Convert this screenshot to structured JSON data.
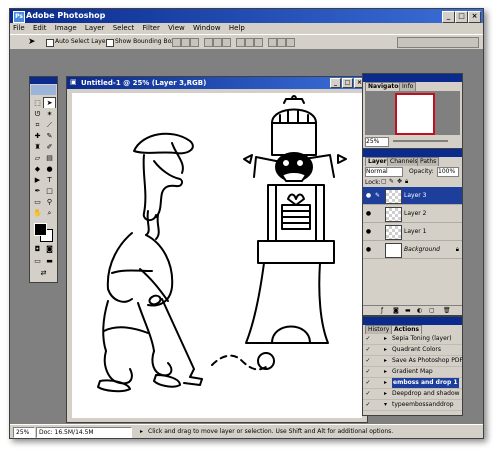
{
  "app": {
    "title": "Adobe Photoshop"
  },
  "menu": [
    "File",
    "Edit",
    "Image",
    "Layer",
    "Select",
    "Filter",
    "View",
    "Window",
    "Help"
  ],
  "options": {
    "auto_select_label": "Auto Select Layer",
    "bounding_box_label": "Show Bounding Box"
  },
  "document": {
    "title": "Untitled-1 @ 25% (Layer 3,RGB)"
  },
  "navigator": {
    "tabs": [
      "Navigator",
      "Info"
    ],
    "zoom": "25%"
  },
  "layers": {
    "tabs": [
      "Layers",
      "Channels",
      "Paths"
    ],
    "blend_mode": "Normal",
    "opacity_label": "Opacity:",
    "opacity_value": "100%",
    "lock_label": "Lock:",
    "items": [
      {
        "name": "Layer 3",
        "selected": true
      },
      {
        "name": "Layer 2",
        "selected": false
      },
      {
        "name": "Layer 1",
        "selected": false
      },
      {
        "name": "Background",
        "selected": false
      }
    ]
  },
  "actions": {
    "tabs": [
      "History",
      "Actions"
    ],
    "items": [
      {
        "name": "Sepia Toning (layer)",
        "selected": false
      },
      {
        "name": "Quadrant Colors",
        "selected": false
      },
      {
        "name": "Save As Photoshop PDF",
        "selected": false
      },
      {
        "name": "Gradient Map",
        "selected": false
      },
      {
        "name": "emboss and drop 1",
        "selected": true
      },
      {
        "name": "Deepdrop and shadow",
        "selected": false
      },
      {
        "name": "typeembossanddrop",
        "selected": false
      }
    ]
  },
  "status": {
    "zoom": "25%",
    "doc_size": "Doc: 16.5M/14.5M",
    "message": "Click and drag to move layer or selection. Use Shift and Alt for additional options."
  }
}
